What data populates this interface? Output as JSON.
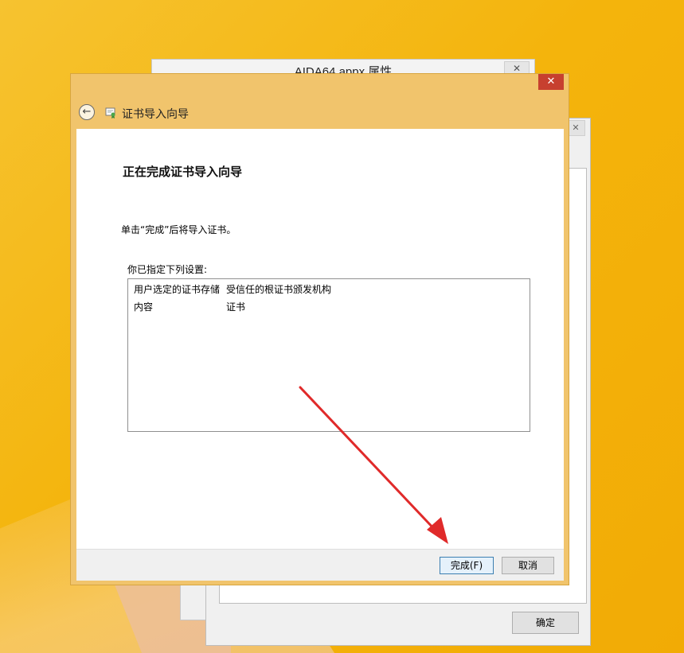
{
  "background_windows": {
    "properties_title": "AIDA64.appx 属性",
    "ok_button": "确定",
    "close_glyph": "✕"
  },
  "wizard": {
    "title": "证书导入向导",
    "close_glyph": "✕",
    "back_glyph": "←",
    "heading": "正在完成证书导入向导",
    "description": "单击“完成”后将导入证书。",
    "settings_label": "你已指定下列设置:",
    "settings": [
      {
        "key": "用户选定的证书存储",
        "value": "受信任的根证书颁发机构"
      },
      {
        "key": "内容",
        "value": "证书"
      }
    ],
    "finish_button": "完成(F)",
    "cancel_button": "取消"
  },
  "icons": {
    "back": "back-arrow-icon",
    "wizard": "certificate-icon",
    "close": "close-icon"
  },
  "colors": {
    "desktop": "#f4b40c",
    "wizard_frame": "#f1c46c",
    "close_button": "#c7402f",
    "annotation_arrow": "#e02a2a"
  }
}
